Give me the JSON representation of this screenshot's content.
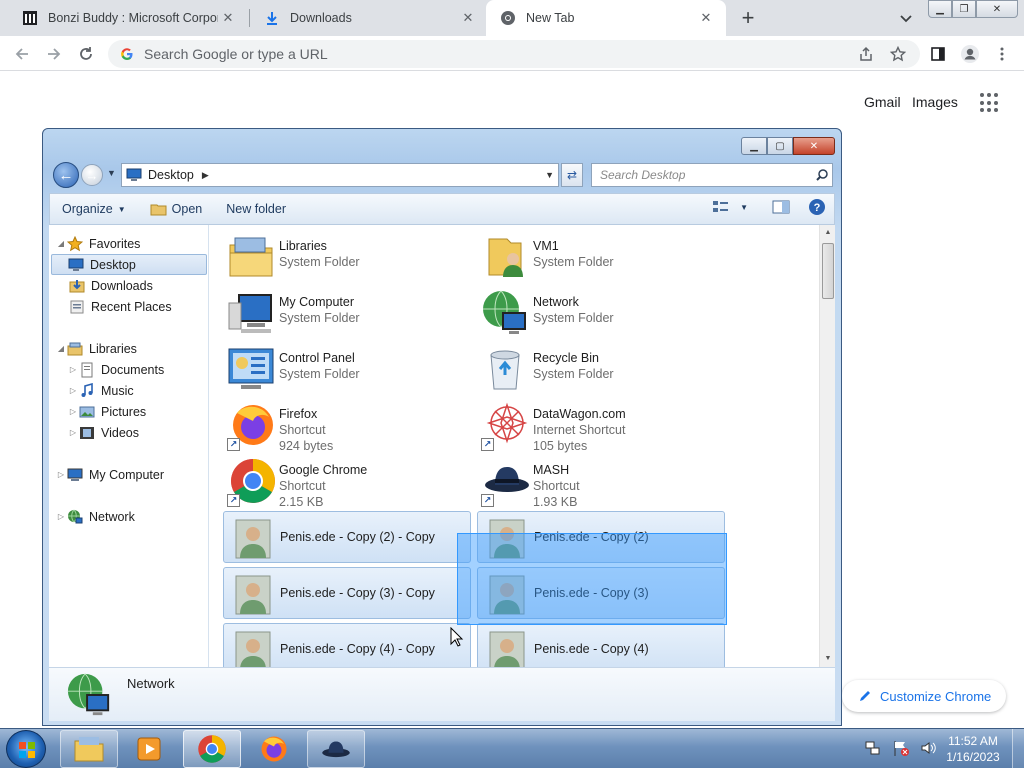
{
  "browser": {
    "tabs": [
      {
        "title": "Bonzi Buddy : Microsoft Corporat",
        "icon": "archive-icon",
        "active": false
      },
      {
        "title": "Downloads",
        "icon": "download-icon",
        "active": false
      },
      {
        "title": "New Tab",
        "icon": "chrome-icon",
        "active": true
      }
    ],
    "omnibox_placeholder": "Search Google or type a URL",
    "ntp_links": {
      "gmail": "Gmail",
      "images": "Images"
    },
    "customize_label": "Customize Chrome",
    "accent": "#1a73e8"
  },
  "explorer": {
    "address": {
      "location": "Desktop"
    },
    "search_placeholder": "Search Desktop",
    "commands": {
      "organize": "Organize",
      "open": "Open",
      "new_folder": "New folder"
    },
    "nav": {
      "favorites": "Favorites",
      "desktop": "Desktop",
      "downloads": "Downloads",
      "recent_places": "Recent Places",
      "libraries": "Libraries",
      "documents": "Documents",
      "music": "Music",
      "pictures": "Pictures",
      "videos": "Videos",
      "my_computer": "My Computer",
      "network": "Network"
    },
    "items": [
      {
        "name": "Libraries",
        "type": "System Folder",
        "size": ""
      },
      {
        "name": "VM1",
        "type": "System Folder",
        "size": ""
      },
      {
        "name": "My Computer",
        "type": "System Folder",
        "size": ""
      },
      {
        "name": "Network",
        "type": "System Folder",
        "size": ""
      },
      {
        "name": "Control Panel",
        "type": "System Folder",
        "size": ""
      },
      {
        "name": "Recycle Bin",
        "type": "System Folder",
        "size": ""
      },
      {
        "name": "Firefox",
        "type": "Shortcut",
        "size": "924 bytes"
      },
      {
        "name": "DataWagon.com",
        "type": "Internet Shortcut",
        "size": "105 bytes"
      },
      {
        "name": "Google Chrome",
        "type": "Shortcut",
        "size": "2.15 KB"
      },
      {
        "name": "MASH",
        "type": "Shortcut",
        "size": "1.93 KB"
      },
      {
        "name": "Penis.ede - Copy (2) - Copy"
      },
      {
        "name": "Penis.ede - Copy (2)"
      },
      {
        "name": "Penis.ede - Copy (3) - Copy"
      },
      {
        "name": "Penis.ede - Copy (3)"
      },
      {
        "name": "Penis.ede - Copy (4) - Copy"
      },
      {
        "name": "Penis.ede - Copy (4)"
      }
    ],
    "details_label": "Network"
  },
  "taskbar": {
    "time": "11:52 AM",
    "date": "1/16/2023"
  }
}
